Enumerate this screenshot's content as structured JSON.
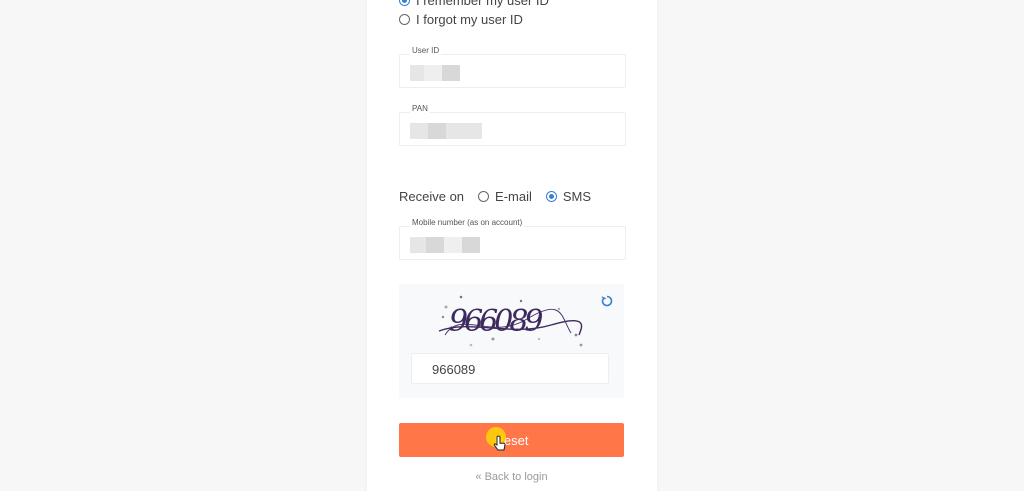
{
  "recovery_options": {
    "remember_label": "I remember my user ID",
    "forgot_label": "I forgot my user ID",
    "selected": "remember"
  },
  "fields": {
    "user_id_label": "User ID",
    "pan_label": "PAN",
    "mobile_label": "Mobile number (as on account)"
  },
  "receive": {
    "label": "Receive on",
    "email_label": "E-mail",
    "sms_label": "SMS",
    "selected": "sms"
  },
  "captcha": {
    "image_text": "966089",
    "input_value": "966089",
    "refresh_icon": "refresh-icon"
  },
  "actions": {
    "reset_label": "Reset",
    "back_label": "« Back to login"
  },
  "colors": {
    "accent_blue": "#387ed1",
    "button_orange": "#ff7649",
    "captcha_ink": "#3d2a5c"
  }
}
